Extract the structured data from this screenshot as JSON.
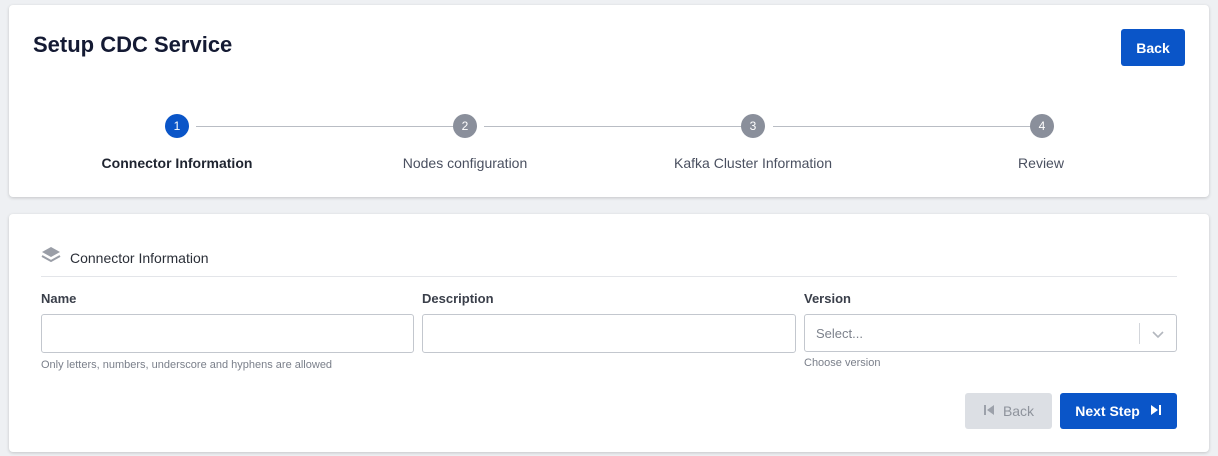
{
  "header": {
    "title": "Setup CDC Service",
    "back_label": "Back"
  },
  "stepper": {
    "steps": [
      {
        "number": "1",
        "label": "Connector Information",
        "active": true
      },
      {
        "number": "2",
        "label": "Nodes configuration",
        "active": false
      },
      {
        "number": "3",
        "label": "Kafka Cluster Information",
        "active": false
      },
      {
        "number": "4",
        "label": "Review",
        "active": false
      }
    ]
  },
  "form": {
    "section_title": "Connector Information",
    "section_icon": "layers-icon",
    "name": {
      "label": "Name",
      "value": "",
      "placeholder": "",
      "hint": "Only letters, numbers, underscore and hyphens are allowed"
    },
    "description": {
      "label": "Description",
      "value": "",
      "placeholder": ""
    },
    "version": {
      "label": "Version",
      "placeholder": "Select...",
      "hint": "Choose version"
    },
    "back_label": "Back",
    "next_label": "Next Step"
  },
  "colors": {
    "primary": "#0a55c8",
    "step_inactive": "#8a8f9b",
    "disabled_bg": "#dcdfe4",
    "background": "#eef0f3"
  }
}
